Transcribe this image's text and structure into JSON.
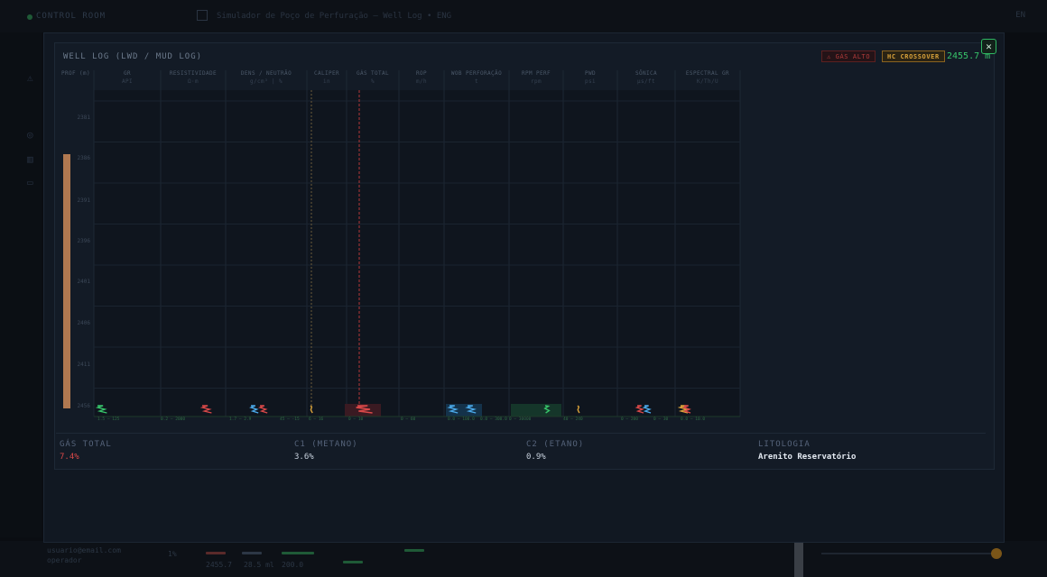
{
  "app": {
    "brand": "CONTROL ROOM",
    "window_title": "Simulador de Poço de Perfuração — Well Log • ENG",
    "right_indicator": "EN"
  },
  "background_bottom": {
    "email": "usuario@email.com",
    "role": "operador",
    "readouts": [
      "2455.7",
      "28.5 ml",
      "200.0"
    ],
    "counter": "1%"
  },
  "modal": {
    "title": "WELL LOG (LWD / MUD LOG)",
    "badges": {
      "gas_alert": "⚠ GÁS ALTO",
      "hc_crossover": "HC CROSSOVER"
    },
    "depth_readout": "2455.7 m",
    "close_symbol": "✕"
  },
  "tracks": [
    {
      "name": "PROF (m)",
      "unit": ""
    },
    {
      "name": "GR",
      "unit": "API"
    },
    {
      "name": "RESISTIVIDADE",
      "unit": "Ω·m"
    },
    {
      "name": "DENS / NEUTRÃO",
      "unit": "g/cm³ | %"
    },
    {
      "name": "CALIPER",
      "unit": "in"
    },
    {
      "name": "GÁS TOTAL",
      "unit": "%"
    },
    {
      "name": "ROP",
      "unit": "m/h"
    },
    {
      "name": "WOB PERFORAÇÃO",
      "unit": "t"
    },
    {
      "name": "RPM PERF",
      "unit": "rpm"
    },
    {
      "name": "PWD",
      "unit": "psi"
    },
    {
      "name": "SÔNICA",
      "unit": "µs/ft"
    },
    {
      "name": "ESPECTRAL GR",
      "unit": "K/Th/U"
    }
  ],
  "depth_ticks": [
    "2381",
    "2386",
    "2391",
    "2396",
    "2401",
    "2406",
    "2411",
    "2456"
  ],
  "chart_data": {
    "type": "line",
    "title": "WELL LOG (LWD / MUD LOG)",
    "y_axis": "PROF (m)",
    "ylim": [
      2376,
      2460
    ],
    "current_depth": 2455.7,
    "gas_total_threshold_pct": 5.0,
    "caliper_reference": 8.5,
    "scales": [
      "1.5 — 125",
      "0.2 — 2000",
      "1.7 — 2.9",
      "45 — -15",
      "6 — 16",
      "0 — 10",
      "0 — 60",
      "0.0 — 100.0",
      "0.0 — 300.0",
      "0 — 30000",
      "40 — 240",
      "0 — 200",
      "0 — 30",
      "0.0 — 10.0"
    ]
  },
  "stats": {
    "gas_total": {
      "label": "GÁS TOTAL",
      "value": "7.4%"
    },
    "c1": {
      "label": "C1 (METANO)",
      "value": "3.6%"
    },
    "c2": {
      "label": "C2 (ETANO)",
      "value": "0.9%"
    },
    "lithology": {
      "label": "LITOLOGIA",
      "value": "Arenito Reservatório"
    }
  },
  "colors": {
    "gr": "#37c46a",
    "resistivity": "#d84848",
    "density": "#4aa8e8",
    "neutron": "#d84848",
    "caliper": "#d9a23a",
    "gas": "#d84848",
    "wob": "#4aa8e8",
    "rpm": "#37c46a",
    "pwd": "#d9a23a",
    "sonic": "#4aa8e8",
    "lithology_bar": "#b07850"
  }
}
